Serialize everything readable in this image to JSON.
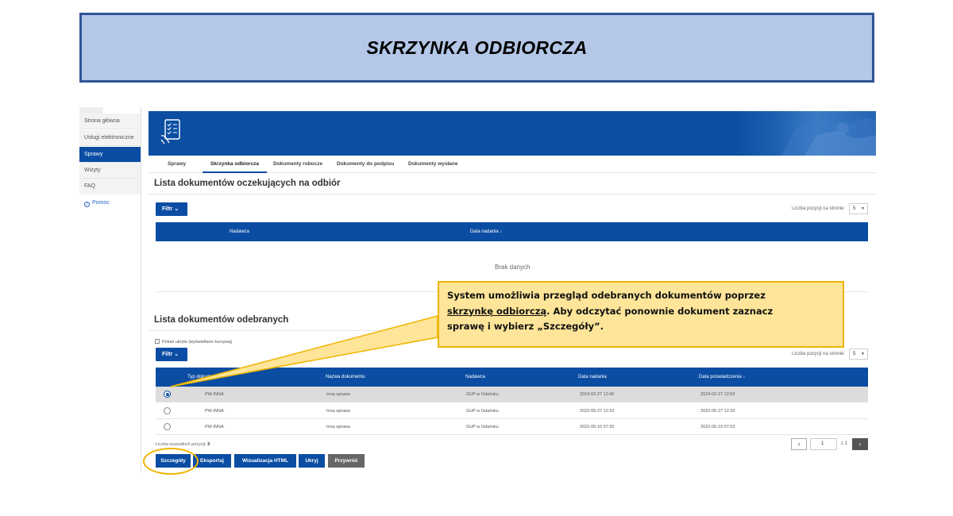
{
  "slide": {
    "title": "SKRZYNKA ODBIORCZA"
  },
  "sidebar": {
    "items": [
      {
        "label": "Strona główna"
      },
      {
        "label": "Usługi elektroniczne"
      },
      {
        "label": "Sprawy"
      },
      {
        "label": "Wizyty"
      },
      {
        "label": "FAQ"
      }
    ],
    "help_label": "Pomoc"
  },
  "tabs": [
    {
      "label": "Sprawy"
    },
    {
      "label": "Skrzynka odbiorcza"
    },
    {
      "label": "Dokumenty robocze"
    },
    {
      "label": "Dokumenty do podpisu"
    },
    {
      "label": "Dokumenty wysłane"
    }
  ],
  "pending": {
    "title": "Lista dokumentów oczekujących na odbiór",
    "filter_label": "Filtr",
    "per_page_label": "Liczba pozycji na stronie:",
    "per_page_value": "5",
    "columns": [
      "Nadawca",
      "Data nadania"
    ],
    "empty_text": "Brak danych"
  },
  "received": {
    "title": "Lista dokumentów odebranych",
    "show_hidden_label": "Pokaż ukryte (wyświetlane kursywą)",
    "filter_label": "Filtr",
    "per_page_label": "Liczba pozycji na stronie:",
    "per_page_value": "5",
    "columns": [
      "Typ dokumentu",
      "Nazwa dokumentu",
      "Nadawca",
      "Data nadania",
      "Data poświadczenia"
    ],
    "rows": [
      {
        "type": "PW-INNA",
        "name": "Inna sprawa",
        "sender": "GUP w Gdańsku",
        "sent": "2024-02-27 12:40",
        "confirmed": "2024-02-27 12:59",
        "selected": true
      },
      {
        "type": "PW-INNA",
        "name": "Inna sprawa",
        "sender": "GUP w Gdańsku",
        "sent": "2022-05-27 12:32",
        "confirmed": "2022-05-27 12:33",
        "selected": false
      },
      {
        "type": "PW-INNA",
        "name": "Inna sprawa",
        "sender": "GUP w Gdańsku",
        "sent": "2022-05-10 07:30",
        "confirmed": "2022-05-10 07:53",
        "selected": false
      }
    ],
    "total_label": "Liczba wszystkich pozycji:",
    "total_value": "3",
    "pager": {
      "prev": "‹",
      "page": "1",
      "of": "z 1",
      "next": "›"
    }
  },
  "actions": {
    "details": "Szczegóły",
    "export": "Eksportuj",
    "html": "Wizualizacja HTML",
    "hide": "Ukryj",
    "restore": "Przywróć"
  },
  "callout": {
    "text_1": "System umożliwia przegląd odebranych dokumentów poprzez",
    "link": "skrzynkę odbiorczą",
    "text_2": ". Aby odczytać ponownie dokument zaznacz",
    "text_3": "sprawę i wybierz „Szczegóły”."
  },
  "colors": {
    "primary": "#0a4da3",
    "callout_bg": "#fee599",
    "callout_border": "#f0b400",
    "banner_bg": "#b4c7e7",
    "banner_border": "#2f5496"
  }
}
